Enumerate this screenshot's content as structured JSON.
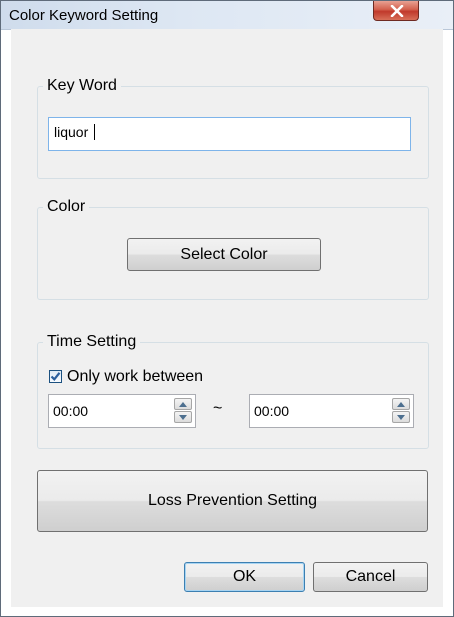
{
  "window": {
    "title": "Color Keyword Setting",
    "close_icon": "close-x-icon"
  },
  "keyword": {
    "legend": "Key Word",
    "value": "liquor "
  },
  "color": {
    "legend": "Color",
    "select_label": "Select Color"
  },
  "time": {
    "legend": "Time Setting",
    "only_work_label": "Only work between",
    "only_work_checked": true,
    "start": "00:00",
    "separator": "~",
    "end": "00:00"
  },
  "loss_prevention_label": "Loss Prevention Setting",
  "footer": {
    "ok_label": "OK",
    "cancel_label": "Cancel"
  },
  "colors": {
    "close_button": "#c0392b",
    "focus_border": "#7eb4ea",
    "checkbox_mark": "#2b5f9e"
  }
}
